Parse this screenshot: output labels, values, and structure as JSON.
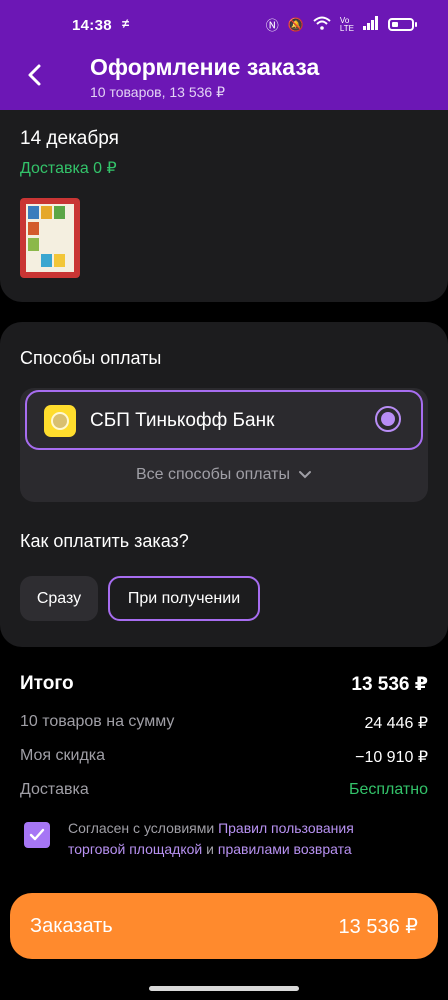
{
  "status_bar": {
    "time": "14:38",
    "icons": [
      "flash-icon",
      "nfc-icon",
      "mute-icon",
      "wifi-icon",
      "volte-icon",
      "signal-icon",
      "battery-icon"
    ]
  },
  "header": {
    "title": "Оформление заказа",
    "subtitle": "10 товаров, 13 536 ₽"
  },
  "delivery": {
    "date": "14 декабря",
    "cost": "Доставка 0 ₽"
  },
  "payment": {
    "heading": "Способы оплаты",
    "selected_method": "СБП Тинькофф Банк",
    "all_methods": "Все способы оплаты"
  },
  "pay_when": {
    "heading": "Как оплатить заказ?",
    "options": [
      "Сразу",
      "При получении"
    ],
    "selected": "При получении"
  },
  "summary": {
    "total_label": "Итого",
    "total_value": "13 536 ₽",
    "rows": [
      {
        "label": "10 товаров на сумму",
        "value": "24 446 ₽"
      },
      {
        "label": "Моя скидка",
        "value": "−10 910 ₽"
      },
      {
        "label": "Доставка",
        "value": "Бесплатно"
      }
    ]
  },
  "agreement": {
    "checked": true,
    "prefix": "Согласен с условиями ",
    "link1": "Правил пользования торговой площадкой",
    "middle": " и ",
    "link2": "правилами возврата"
  },
  "order_button": {
    "label": "Заказать",
    "amount": "13 536 ₽"
  },
  "colors": {
    "header_bg": "#6c17b5",
    "accent_purple": "#a76df0",
    "green": "#33c36a",
    "order_button": "#ff8a2d"
  }
}
